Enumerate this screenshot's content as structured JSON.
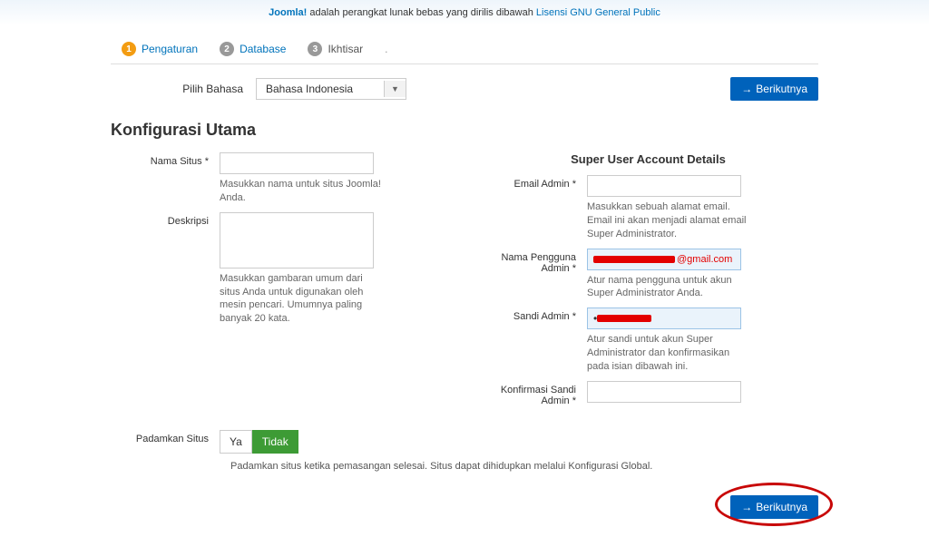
{
  "topbar": {
    "brand": "Joomla!",
    "text_mid": " adalah perangkat lunak bebas yang dirilis dibawah ",
    "license_link": "Lisensi GNU General Public"
  },
  "tabs": [
    {
      "num": "1",
      "label": "Pengaturan"
    },
    {
      "num": "2",
      "label": "Database"
    },
    {
      "num": "3",
      "label": "Ikhtisar"
    }
  ],
  "lang": {
    "label": "Pilih Bahasa",
    "value": "Bahasa Indonesia"
  },
  "buttons": {
    "next": "Berikutnya",
    "ya": "Ya",
    "tidak": "Tidak"
  },
  "section_title": "Konfigurasi Utama",
  "left": {
    "nama_situs_label": "Nama Situs *",
    "nama_situs_help": "Masukkan nama untuk situs Joomla! Anda.",
    "deskripsi_label": "Deskripsi",
    "deskripsi_help": "Masukkan gambaran umum dari situs Anda untuk digunakan oleh mesin pencari. Umumnya paling banyak 20 kata."
  },
  "right": {
    "header": "Super User Account Details",
    "email_label": "Email Admin *",
    "email_help": "Masukkan sebuah alamat email. Email ini akan menjadi alamat email Super Administrator.",
    "username_label": "Nama Pengguna Admin *",
    "username_suffix": "@gmail.com",
    "username_help": "Atur nama pengguna untuk akun Super Administrator Anda.",
    "password_label": "Sandi Admin *",
    "password_help": "Atur sandi untuk akun Super Administrator dan konfirmasikan pada isian dibawah ini.",
    "confirm_label": "Konfirmasi Sandi Admin *"
  },
  "offline": {
    "label": "Padamkan Situs",
    "help": "Padamkan situs ketika pemasangan selesai. Situs dapat dihidupkan melalui Konfigurasi Global."
  }
}
